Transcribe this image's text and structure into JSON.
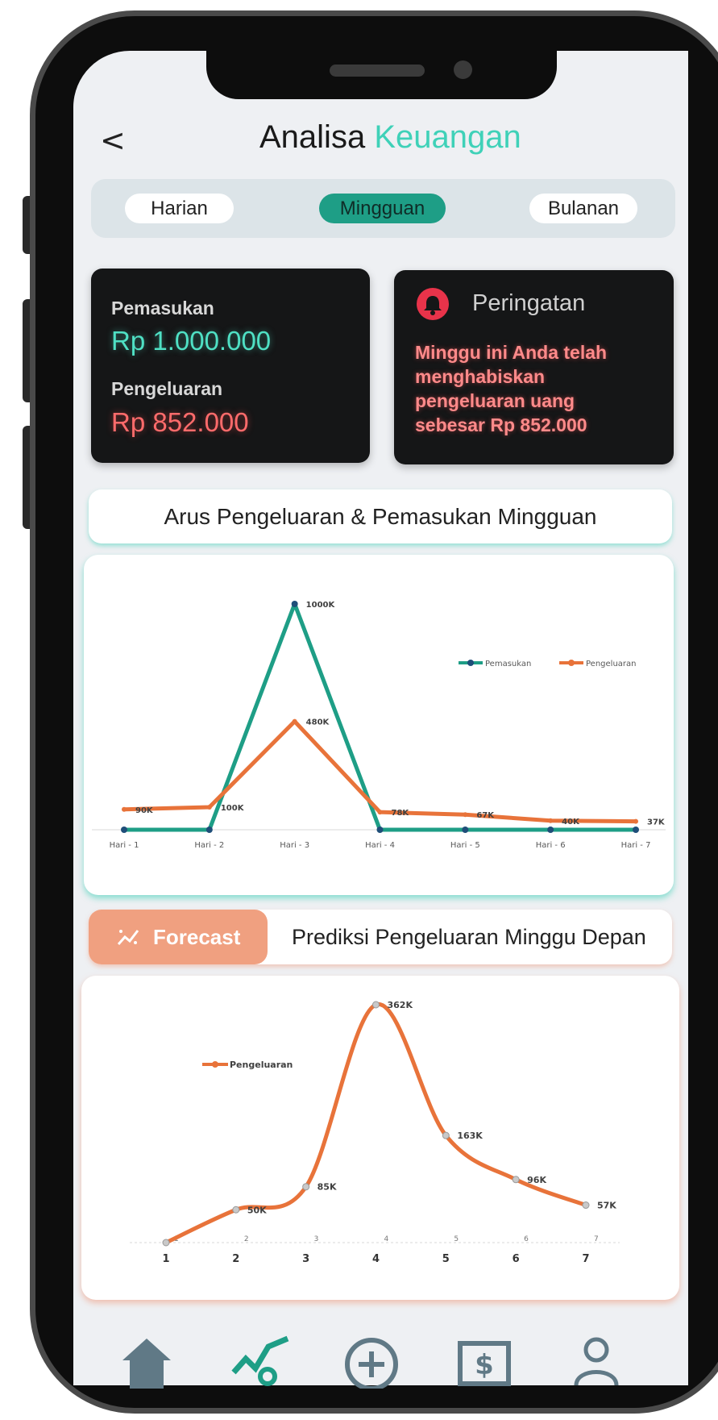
{
  "header": {
    "back_label": "<",
    "title_main": "Analisa",
    "title_accent": "Keuangan"
  },
  "tabs": [
    {
      "label": "Harian",
      "active": false
    },
    {
      "label": "Mingguan",
      "active": true
    },
    {
      "label": "Bulanan",
      "active": false
    }
  ],
  "summary": {
    "income_label": "Pemasukan",
    "income_value": "Rp 1.000.000",
    "expense_label": "Pengeluaran",
    "expense_value": "Rp 852.000"
  },
  "warning": {
    "icon": "bell-icon",
    "title": "Peringatan",
    "message": "Minggu ini Anda telah menghabiskan pengeluaran uang sebesar Rp 852.000"
  },
  "weekly_section_title": "Arus Pengeluaran & Pemasukan Mingguan",
  "forecast": {
    "pill_label": "Forecast",
    "pill_icon": "trend-icon",
    "title": "Prediksi Pengeluaran Minggu Depan"
  },
  "colors": {
    "teal": "#1e9e86",
    "orange": "#e8733a",
    "accent": "#3fd1b8",
    "warning_red": "#e8334a"
  },
  "chart_data": [
    {
      "type": "line",
      "categories": [
        "Hari - 1",
        "Hari - 2",
        "Hari - 3",
        "Hari - 4",
        "Hari - 5",
        "Hari - 6",
        "Hari - 7"
      ],
      "series": [
        {
          "name": "Pemasukan",
          "values": [
            0,
            0,
            1000,
            0,
            0,
            0,
            0
          ],
          "labels": [
            "",
            "",
            "1000K",
            "",
            "",
            "",
            ""
          ]
        },
        {
          "name": "Pengeluaran",
          "values": [
            90,
            100,
            480,
            78,
            67,
            40,
            37
          ],
          "labels": [
            "90K",
            "100K",
            "480K",
            "78K",
            "67K",
            "40K",
            "37K"
          ]
        }
      ],
      "legend": "top-right",
      "ylim": [
        0,
        1000
      ]
    },
    {
      "type": "line",
      "categories": [
        "1",
        "2",
        "3",
        "4",
        "5",
        "6",
        "7"
      ],
      "series": [
        {
          "name": "Pengeluaran",
          "values": [
            0,
            50,
            85,
            362,
            163,
            96,
            57
          ],
          "labels": [
            "",
            "50K",
            "85K",
            "362K",
            "163K",
            "96K",
            "57K"
          ]
        }
      ],
      "point_labels": [
        "1",
        "2",
        "3",
        "4",
        "5",
        "6",
        "7"
      ],
      "legend": "top-left",
      "ylim": [
        0,
        362
      ],
      "smooth": true
    }
  ],
  "nav": [
    {
      "icon": "home-icon",
      "active": false
    },
    {
      "icon": "analytics-icon",
      "active": true
    },
    {
      "icon": "add-circle-icon",
      "active": false
    },
    {
      "icon": "money-icon",
      "active": false
    },
    {
      "icon": "profile-icon",
      "active": false
    }
  ]
}
